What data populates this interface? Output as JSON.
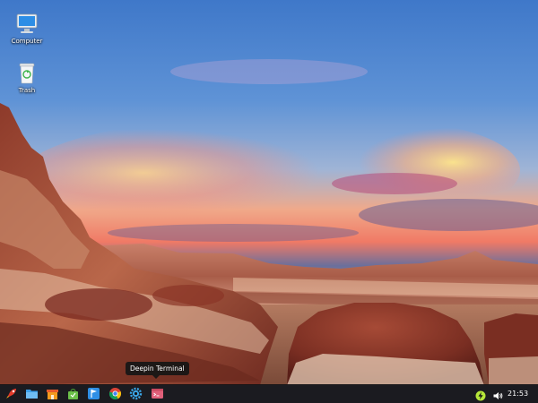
{
  "desktop": {
    "icons": [
      {
        "label": "Computer",
        "icon": "computer-icon"
      },
      {
        "label": "Trash",
        "icon": "trash-icon"
      }
    ]
  },
  "tooltip": {
    "text": "Deepin Terminal"
  },
  "taskbar": {
    "dock": [
      {
        "name": "launcher",
        "icon": "rocket-icon"
      },
      {
        "name": "file-manager",
        "icon": "folder-icon"
      },
      {
        "name": "store",
        "icon": "store-icon"
      },
      {
        "name": "software-center",
        "icon": "shopping-bag-icon"
      },
      {
        "name": "music-player",
        "icon": "flag-icon"
      },
      {
        "name": "browser",
        "icon": "chrome-icon"
      },
      {
        "name": "settings",
        "icon": "gear-icon"
      },
      {
        "name": "terminal",
        "icon": "terminal-icon"
      }
    ],
    "tray": {
      "battery_icon": "battery-charging-icon",
      "volume_icon": "speaker-icon",
      "clock": "21:53"
    }
  },
  "colors": {
    "taskbar_bg": "#121216",
    "tooltip_bg": "#161616",
    "launcher_red": "#e23a2a",
    "folder_blue": "#3a9ee8",
    "store_orange": "#f39a1e",
    "bag_green": "#6cc04a",
    "flag_blue": "#2f8fe6",
    "gear_blue": "#3aa7e8",
    "terminal_pink": "#e0607a",
    "battery_green": "#b6e63a"
  }
}
